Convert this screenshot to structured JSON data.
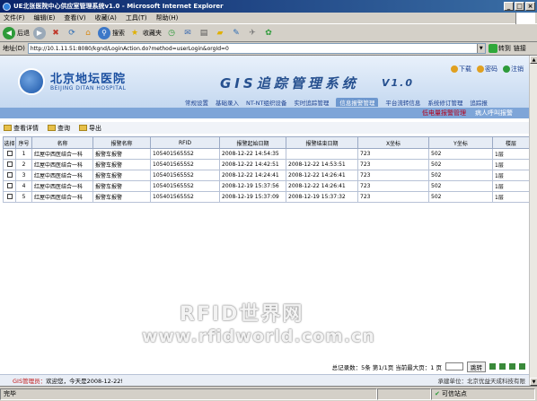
{
  "window": {
    "title": "UE北张医院中心供应室管理系统v1.0 - Microsoft Internet Explorer",
    "min": "_",
    "max": "□",
    "close": "×"
  },
  "menu": [
    "文件(F)",
    "编辑(E)",
    "查看(V)",
    "收藏(A)",
    "工具(T)",
    "帮助(H)"
  ],
  "toolbar": {
    "back": "后退",
    "search": "搜索",
    "favorites": "收藏夹"
  },
  "address": {
    "label": "地址(D)",
    "url": "http://10.1.11.51:8080/kgnd/LoginAction.do?method=userLogin&orgId=0",
    "go": "转到",
    "links": "链接"
  },
  "header": {
    "logo_cn": "北京地坛医院",
    "logo_en": "BEIJING DITAN HOSPITAL",
    "title": "GIS追踪管理系统",
    "version": "V1.0",
    "links": [
      "下载",
      "密码",
      "注销"
    ]
  },
  "nav": [
    "常规设置",
    "基础录入",
    "NT-NT组织设备",
    "实时追踪管理",
    "信息报警管理",
    "平台流转信息",
    "系统修订管理",
    "追踪报"
  ],
  "subnav": [
    "低电量报警管理",
    "病人呼叫报警"
  ],
  "actions": [
    "查看详情",
    "查询",
    "导出"
  ],
  "table": {
    "headers": [
      "选择",
      "序号",
      "名称",
      "报警名称",
      "RFID",
      "报警起始日期",
      "报警结束日期",
      "X坐标",
      "Y坐标",
      "楼层"
    ],
    "rows": [
      [
        "",
        "1",
        "红屋中西医结合一科",
        "报警车报警",
        "1054015655S2",
        "2008-12-22 14:54:35",
        "",
        "723",
        "502",
        "1层"
      ],
      [
        "",
        "2",
        "红屋中西医结合一科",
        "报警车报警",
        "1054015655S2",
        "2008-12-22 14:42:51",
        "2008-12-22 14:53:51",
        "723",
        "502",
        "1层"
      ],
      [
        "",
        "3",
        "红屋中西医结合一科",
        "报警车报警",
        "1054015655S2",
        "2008-12-22 14:24:41",
        "2008-12-22 14:26:41",
        "723",
        "502",
        "1层"
      ],
      [
        "",
        "4",
        "红屋中西医结合一科",
        "报警车报警",
        "1054015655S2",
        "2008-12-19 15:37:56",
        "2008-12-22 14:26:41",
        "723",
        "502",
        "1层"
      ],
      [
        "",
        "5",
        "红屋中西医结合一科",
        "报警车报警",
        "1054015655S2",
        "2008-12-19 15:37:09",
        "2008-12-19 15:37:32",
        "723",
        "502",
        "1层"
      ]
    ]
  },
  "pager": {
    "summary": "总记录数：5条 第1/1页 当前最大页：1 页",
    "jump": "跳转"
  },
  "footer": {
    "prefix": "GIS管理员：",
    "welcome": "欢迎您，今天是2008-12-22!",
    "org": "承建单位：北京优益天成科技有限"
  },
  "status": {
    "left": "完毕",
    "zone": "可信站点"
  },
  "watermark": {
    "line1": "RFID世界网",
    "line2": "www.rfidworld.com.cn"
  }
}
